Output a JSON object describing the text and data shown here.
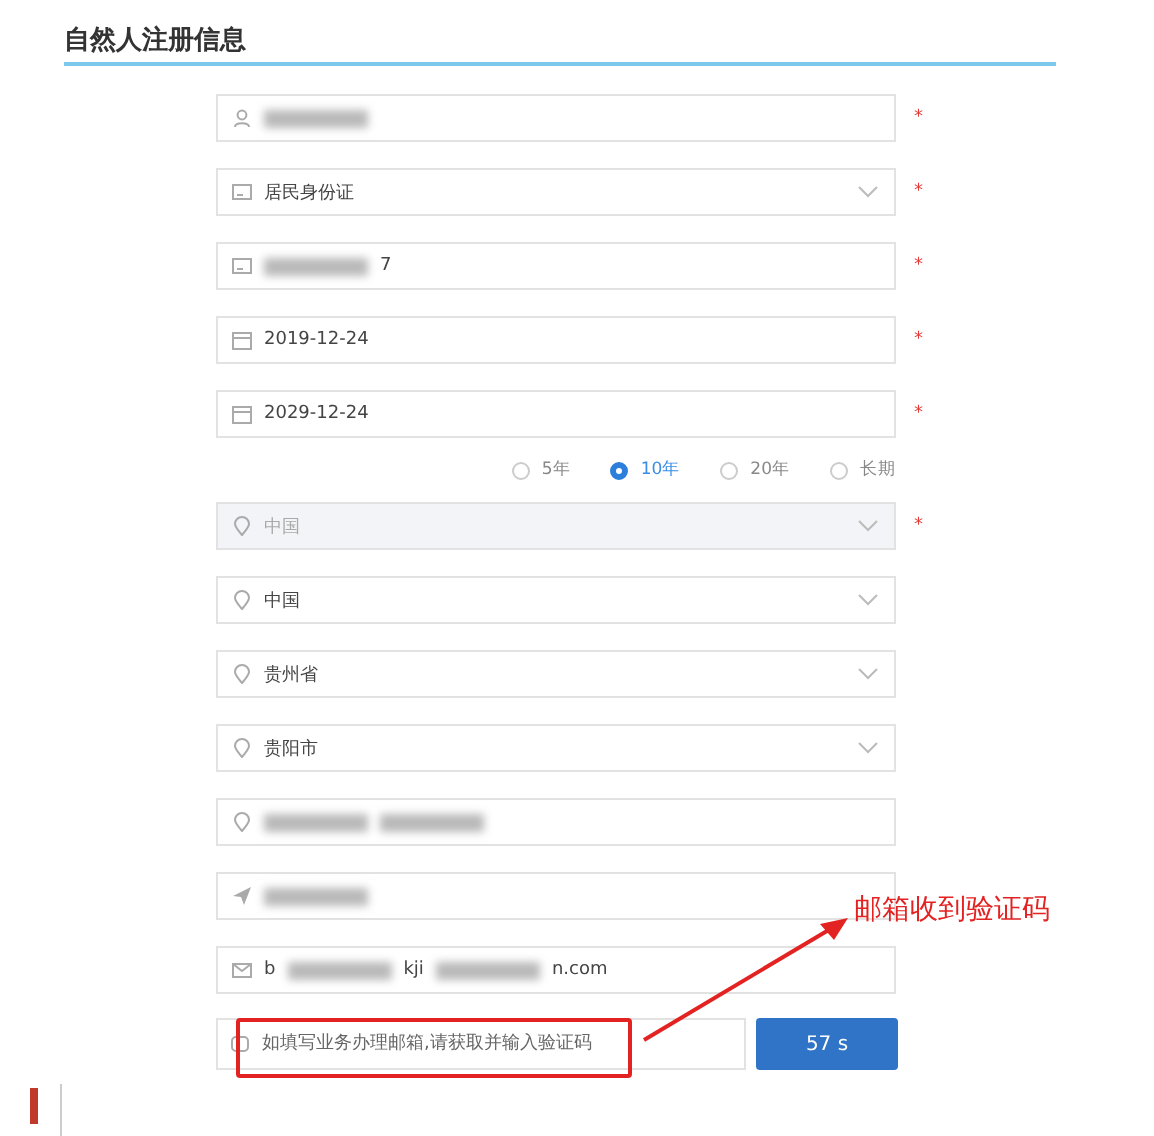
{
  "section_title": "自然人注册信息",
  "fields": [
    {
      "kind": "text",
      "required": true,
      "disabled": false,
      "segments": [
        {
          "kind": "blur"
        }
      ]
    },
    {
      "kind": "select",
      "required": true,
      "disabled": false,
      "segments": [
        {
          "kind": "text",
          "text": "居民身份证"
        }
      ]
    },
    {
      "kind": "text",
      "required": true,
      "disabled": false,
      "segments": [
        {
          "kind": "blur"
        },
        {
          "kind": "text",
          "text": "7"
        }
      ]
    },
    {
      "kind": "text",
      "required": true,
      "disabled": false,
      "segments": [
        {
          "kind": "text",
          "text": "2019-12-24"
        }
      ]
    },
    {
      "kind": "text",
      "required": true,
      "disabled": false,
      "segments": [
        {
          "kind": "text",
          "text": "2029-12-24"
        }
      ]
    },
    {
      "kind": "radios",
      "options": [
        {
          "label": "5年",
          "selected": false
        },
        {
          "label": "10年",
          "selected": true
        },
        {
          "label": "20年",
          "selected": false
        },
        {
          "label": "长期",
          "selected": false
        }
      ]
    },
    {
      "kind": "select",
      "required": true,
      "disabled": true,
      "segments": [
        {
          "kind": "text",
          "text": "中国"
        }
      ]
    },
    {
      "kind": "select",
      "required": false,
      "disabled": false,
      "segments": [
        {
          "kind": "text",
          "text": "中国"
        }
      ]
    },
    {
      "kind": "select",
      "required": false,
      "disabled": false,
      "segments": [
        {
          "kind": "text",
          "text": "贵州省"
        }
      ]
    },
    {
      "kind": "select",
      "required": false,
      "disabled": false,
      "segments": [
        {
          "kind": "text",
          "text": "贵阳市"
        }
      ]
    },
    {
      "kind": "text",
      "required": false,
      "disabled": false,
      "segments": [
        {
          "kind": "blur"
        },
        {
          "kind": "blur"
        }
      ]
    },
    {
      "kind": "text",
      "required": false,
      "disabled": false,
      "segments": [
        {
          "kind": "blur"
        }
      ]
    },
    {
      "kind": "text",
      "required": false,
      "disabled": false,
      "segments": [
        {
          "kind": "text",
          "text": "b"
        },
        {
          "kind": "blur"
        },
        {
          "kind": "text",
          "text": "kji"
        },
        {
          "kind": "blur"
        },
        {
          "kind": "text",
          "text": "n.com"
        }
      ]
    },
    {
      "kind": "code",
      "placeholder": "如填写业务办理邮箱,请获取并输入验证码",
      "button": "57 s"
    }
  ],
  "required_mark": "*",
  "annotation": {
    "text": "邮箱收到验证码"
  }
}
